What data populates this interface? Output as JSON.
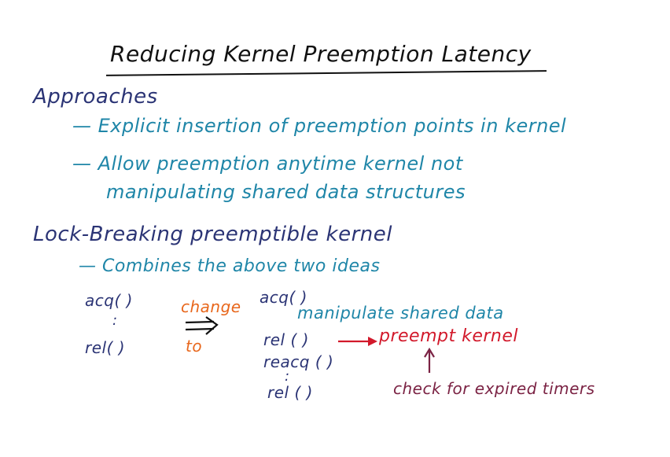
{
  "title": "Reducing Kernel Preemption Latency",
  "approaches": {
    "heading": "Approaches",
    "items": [
      "— Explicit insertion of preemption points in kernel",
      "— Allow preemption anytime kernel not",
      "manipulating shared data structures"
    ]
  },
  "lock_breaking": {
    "heading": "Lock-Breaking preemptible kernel",
    "combines": "— Combines the above two ideas"
  },
  "diagram": {
    "left": {
      "acq": "acq( )",
      "dots": ":",
      "rel": "rel( )"
    },
    "change_label": "change",
    "to_label": "to",
    "right": {
      "acq": "acq( )",
      "manipulate": "manipulate shared data",
      "rel": "rel ( )",
      "reacq": "reacq ( )",
      "dots": ":",
      "rel2": "rel ( )"
    },
    "preempt_kernel": "preempt kernel",
    "check_timers": "check for expired timers"
  },
  "colors": {
    "title": "#111111",
    "headings": "#2b3475",
    "bullets": "#1f86a8",
    "change": "#e8671c",
    "preempt": "#d2192b",
    "check": "#7b2344"
  }
}
